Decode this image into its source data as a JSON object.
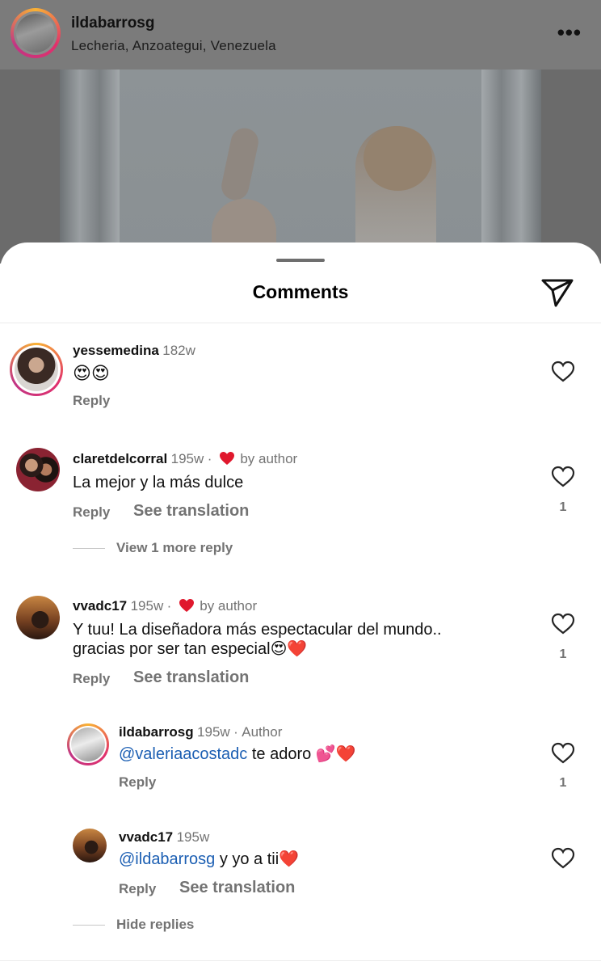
{
  "post": {
    "username": "ildabarrosg",
    "location": "Lecheria, Anzoategui, Venezuela",
    "more_icon": "more-icon"
  },
  "sheet": {
    "title": "Comments",
    "send_icon": "send-icon"
  },
  "comments": [
    {
      "username": "yessemedina",
      "time": "182w",
      "text": "😍😍",
      "reply": "Reply",
      "likes": ""
    },
    {
      "username": "claretdelcorral",
      "time": "195w",
      "liked_by_author": "by author",
      "text": "La mejor y la más dulce",
      "reply": "Reply",
      "see_translation": "See translation",
      "likes": "1",
      "view_more": "View 1 more reply"
    },
    {
      "username": "vvadc17",
      "time": "195w",
      "liked_by_author": "by author",
      "text_line1": "Y tuu! La diseñadora más espectacular del mundo..",
      "text_line2": "gracias por ser tan especial😍❤️",
      "reply": "Reply",
      "see_translation": "See translation",
      "likes": "1",
      "replies": [
        {
          "username": "ildabarrosg",
          "time": "195w",
          "badge": "Author",
          "mention": "@valeriaacostadc",
          "text": "te adoro 💕❤️",
          "reply": "Reply",
          "likes": "1"
        },
        {
          "username": "vvadc17",
          "time": "195w",
          "mention": "@ildabarrosg",
          "text": "y yo a tii❤️",
          "reply": "Reply",
          "see_translation": "See translation",
          "likes": ""
        }
      ],
      "hide_replies": "Hide replies"
    }
  ],
  "colors": {
    "mention": "#1c5fb3",
    "heart_red": "#e0182d",
    "meta_gray": "#737373"
  }
}
